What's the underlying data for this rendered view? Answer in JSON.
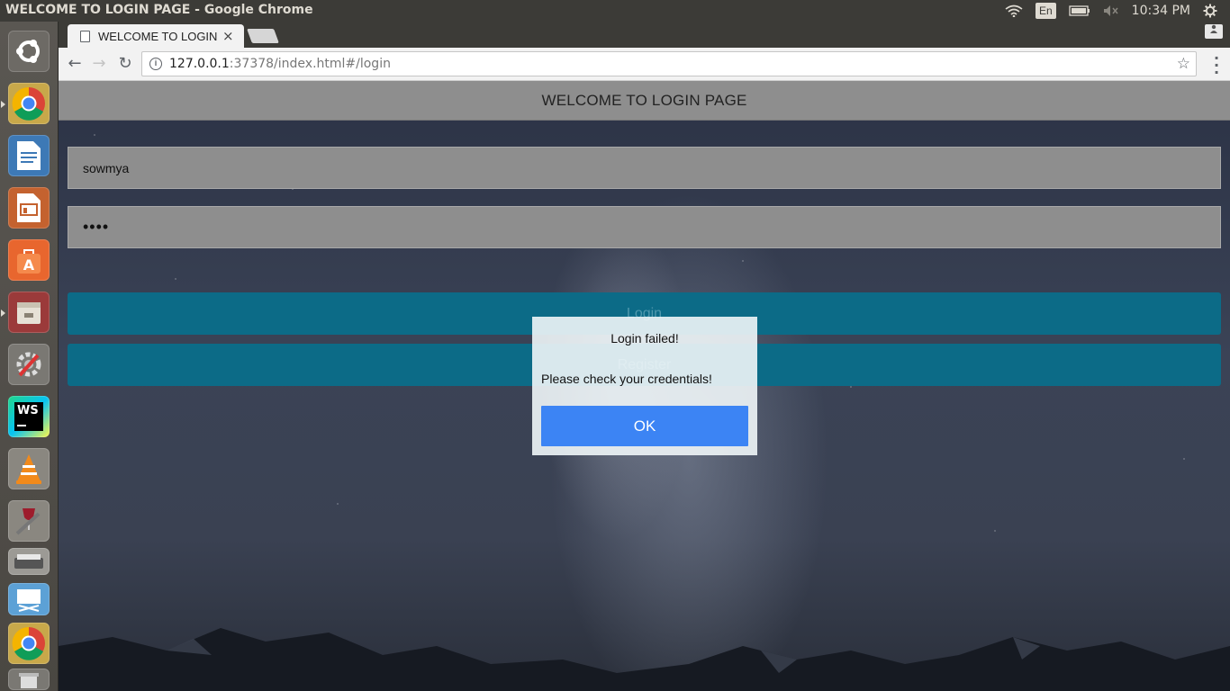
{
  "os": {
    "window_title": "WELCOME TO LOGIN PAGE - Google Chrome",
    "keyboard_layout": "En",
    "clock": "10:34 PM",
    "launcher_icons": [
      "ubuntu-dash-icon",
      "chrome-icon",
      "libreoffice-writer-icon",
      "libreoffice-impress-icon",
      "software-center-icon",
      "files-icon",
      "system-settings-icon",
      "webstorm-icon",
      "vlc-icon",
      "wine-tools-icon",
      "scanner-icon",
      "remote-desktop-icon",
      "chrome-icon",
      "trash-icon"
    ]
  },
  "browser": {
    "tab_title": "WELCOME TO LOGIN PAGE",
    "tab_close": "×",
    "url_host": "127.0.0.1",
    "url_rest": ":37378/index.html#/login",
    "back_icon": "←",
    "forward_icon": "→",
    "reload_icon": "↻",
    "info_icon": "i",
    "star_icon": "☆"
  },
  "page": {
    "header_title": "WELCOME TO LOGIN PAGE",
    "username_value": "sowmya",
    "password_value": "••••",
    "login_button": "Login",
    "register_button": "Register"
  },
  "alert": {
    "title": "Login failed!",
    "message": "Please check your credentials!",
    "ok_button": "OK"
  },
  "colors": {
    "header_bg": "#8e8e8e",
    "button_bg": "#0c6b87",
    "ok_button_bg": "#3c84f4"
  }
}
